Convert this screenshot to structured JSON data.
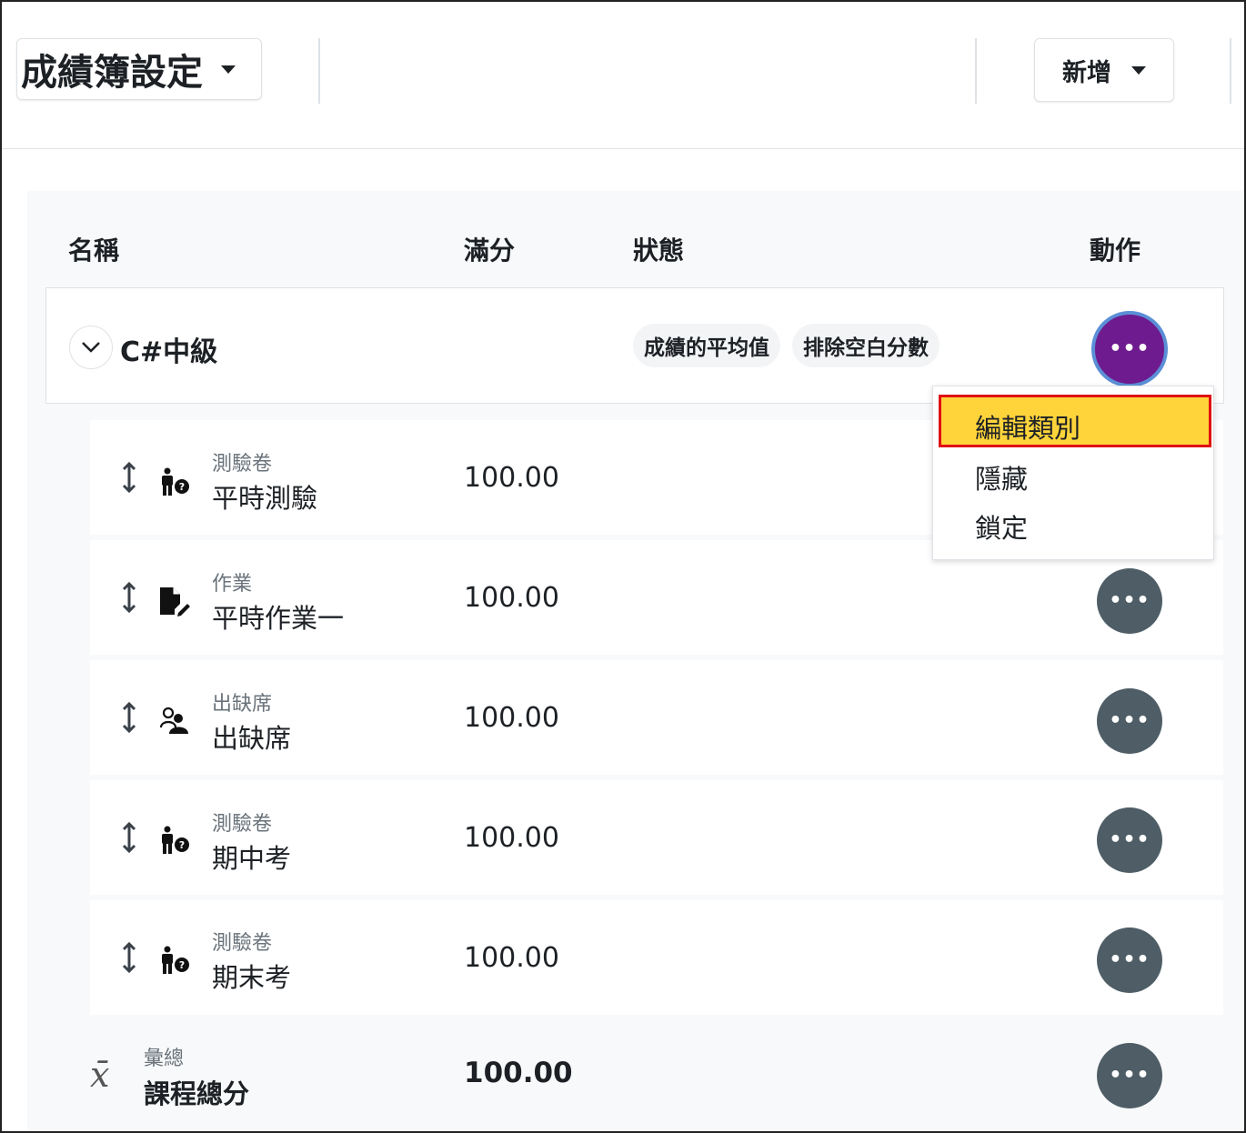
{
  "header": {
    "title": "成績簿設定",
    "add_label": "新增"
  },
  "table": {
    "columns": {
      "name": "名稱",
      "max": "滿分",
      "status": "狀態",
      "actions": "動作"
    },
    "category": {
      "name": "C#中級",
      "badges": [
        "成績的平均值",
        "排除空白分數"
      ]
    },
    "items": [
      {
        "type": "測驗卷",
        "name": "平時測驗",
        "max": "100.00",
        "icon": "quiz-icon"
      },
      {
        "type": "作業",
        "name": "平時作業一",
        "max": "100.00",
        "icon": "assignment-icon"
      },
      {
        "type": "出缺席",
        "name": "出缺席",
        "max": "100.00",
        "icon": "attendance-icon"
      },
      {
        "type": "測驗卷",
        "name": "期中考",
        "max": "100.00",
        "icon": "quiz-icon"
      },
      {
        "type": "測驗卷",
        "name": "期末考",
        "max": "100.00",
        "icon": "quiz-icon"
      }
    ],
    "total": {
      "type": "彙總",
      "name": "課程總分",
      "max": "100.00"
    }
  },
  "dropdown": {
    "items": [
      "編輯類別",
      "隱藏",
      "鎖定"
    ],
    "highlighted": 0
  },
  "colors": {
    "accent_purple": "#6d1b8e",
    "action_gray": "#4e5d66",
    "highlight": "#ffd43b",
    "highlight_border": "#e01010"
  }
}
